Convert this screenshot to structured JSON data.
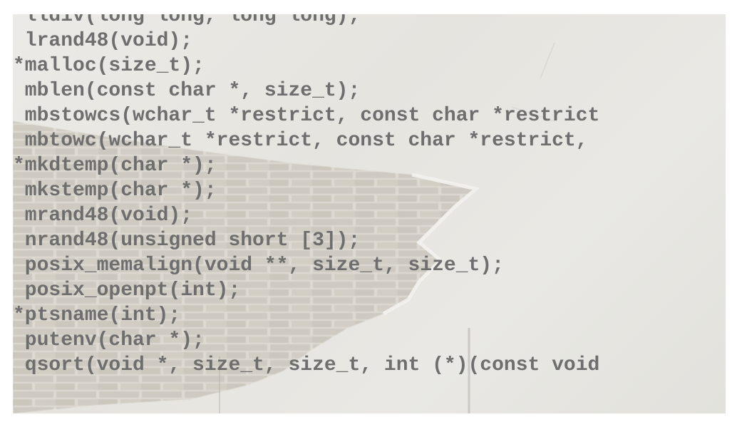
{
  "code_lines": [
    " lldiv(long long, long long);",
    " lrand48(void);",
    "*malloc(size_t);",
    " mblen(const char *, size_t);",
    " mbstowcs(wchar_t *restrict, const char *restrict",
    " mbtowc(wchar_t *restrict, const char *restrict,",
    "*mkdtemp(char *);",
    " mkstemp(char *);",
    " mrand48(void);",
    " nrand48(unsigned short [3]);",
    " posix_memalign(void **, size_t, size_t);",
    " posix_openpt(int);",
    "*ptsname(int);",
    " putenv(char *);",
    " qsort(void *, size_t, size_t, int (*)(const void"
  ],
  "colors": {
    "text": "#6e6e6e",
    "plaster": "#e8e6e2",
    "brick": "#c9c4ba",
    "mortar": "#ddd9d1"
  }
}
